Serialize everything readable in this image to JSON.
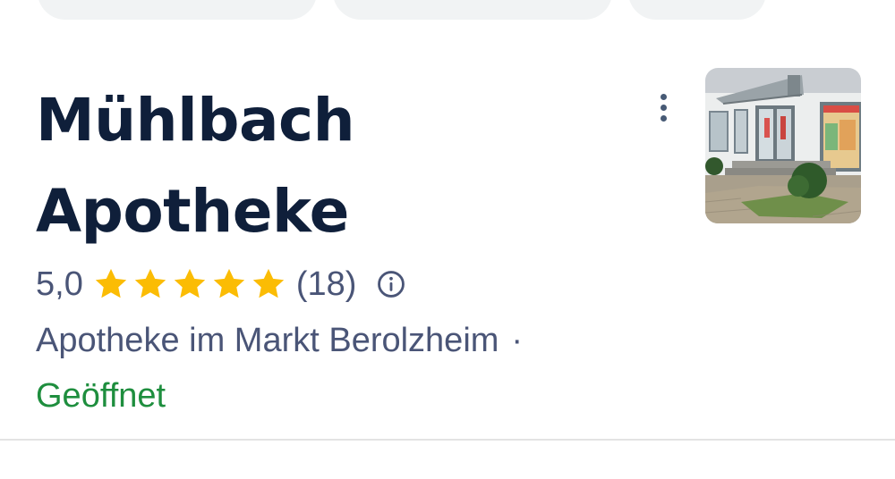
{
  "place": {
    "title_line1": "Mühlbach",
    "title_line2": "Apotheke",
    "rating": "5,0",
    "stars": 5,
    "reviews": "(18)",
    "category": "Apotheke im Markt Berolzheim",
    "separator": "·",
    "status": "Geöffnet"
  },
  "icons": {
    "more": "more-vert-icon",
    "info": "info-icon",
    "star": "star-icon"
  },
  "colors": {
    "title": "#0f1f3a",
    "secondary": "#4a5577",
    "star": "#fbbc04",
    "open_status": "#1e8e3e",
    "chip": "#f1f3f4",
    "divider": "#e3e3e3"
  }
}
